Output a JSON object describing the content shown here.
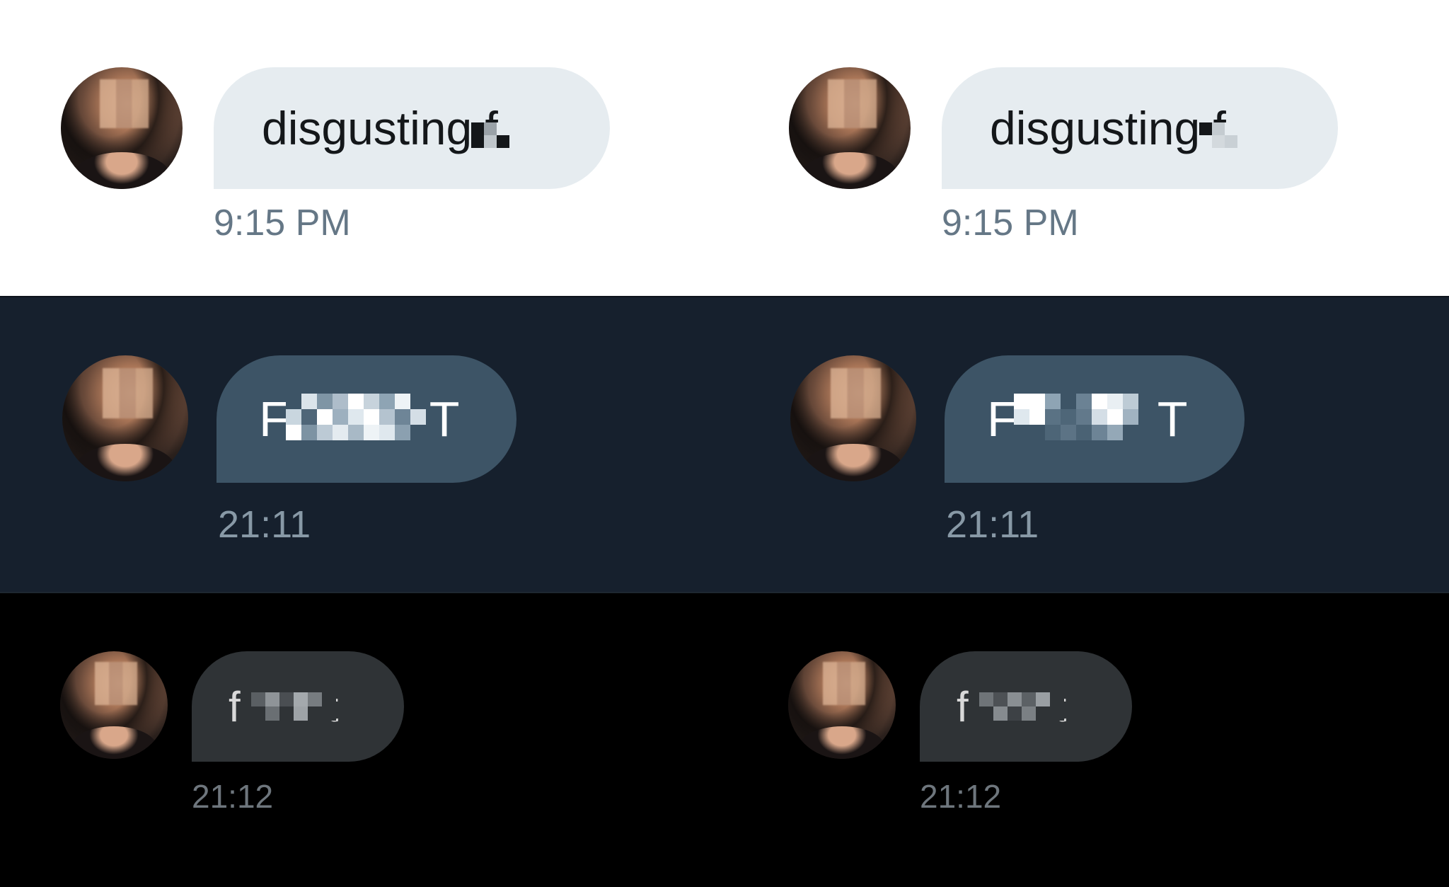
{
  "themes": {
    "light": {
      "left": {
        "message": "disgusting f",
        "time": "9:15 PM"
      },
      "right": {
        "message": "disgusting f",
        "time": "9:15 PM"
      }
    },
    "dim": {
      "left": {
        "message": "F",
        "message_end": "T",
        "time": "21:11"
      },
      "right": {
        "message": "F",
        "message_end": "T",
        "time": "21:11"
      }
    },
    "black": {
      "left": {
        "message": "f",
        "message_end": "t",
        "time": "21:12"
      },
      "right": {
        "message": "f",
        "message_end": "t",
        "time": "21:12"
      }
    }
  },
  "colors": {
    "light_bg": "#ffffff",
    "light_bubble": "#e6ecf0",
    "dim_bg": "#16202d",
    "dim_bubble": "#3d5466",
    "black_bg": "#000000",
    "black_bubble": "#2f3336"
  },
  "icons": {
    "avatar": "user-avatar-photo"
  }
}
